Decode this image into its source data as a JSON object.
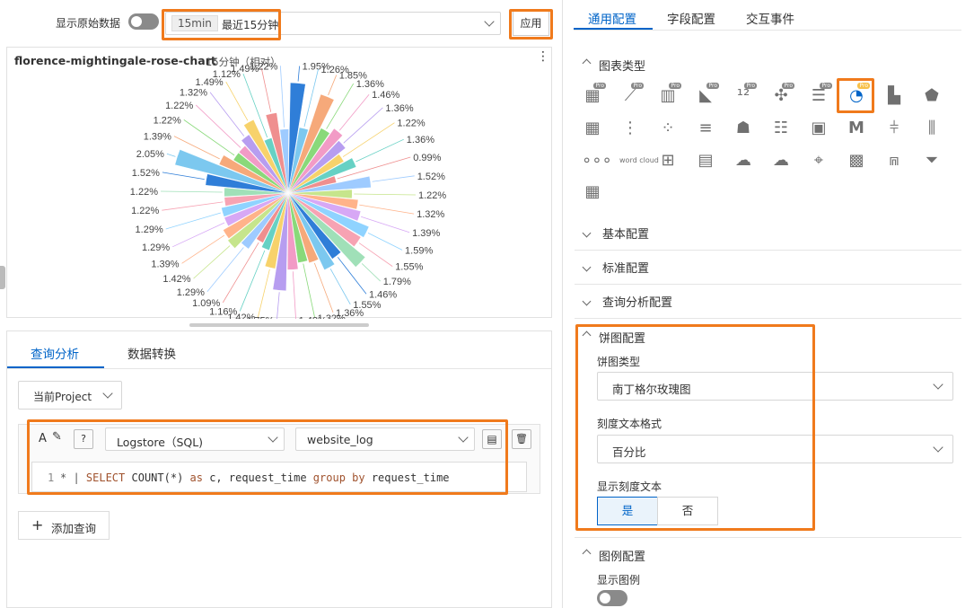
{
  "top": {
    "raw_label": "显示原始数据",
    "time_badge": "15min",
    "time_text": "最近15分钟",
    "apply": "应用"
  },
  "chart_panel": {
    "title": "florence-mightingale-rose-chart",
    "subtitle": "15分钟（相对）"
  },
  "chart_data": {
    "type": "pie",
    "variant": "nightingale-rose",
    "labels": [
      "1.95%",
      "1.26%",
      "1.85%",
      "1.36%",
      "1.46%",
      "1.36%",
      "1.22%",
      "1.36%",
      "0.99%",
      "1.52%",
      "1.22%",
      "1.32%",
      "1.39%",
      "1.59%",
      "1.55%",
      "1.79%",
      "1.46%",
      "1.55%",
      "1.36%",
      "1.32%",
      "1.42%",
      "1.75%",
      "1.42%",
      "1.16%",
      "1.09%",
      "1.29%",
      "1.42%",
      "1.39%",
      "1.29%",
      "1.29%",
      "1.22%",
      "1.22%",
      "1.52%",
      "2.05%",
      "1.39%",
      "1.22%",
      "1.22%",
      "1.32%",
      "1.49%",
      "1.12%",
      "1.49%",
      "1.22%"
    ],
    "values": [
      1.95,
      1.26,
      1.85,
      1.36,
      1.46,
      1.36,
      1.22,
      1.36,
      0.99,
      1.52,
      1.22,
      1.32,
      1.39,
      1.59,
      1.55,
      1.79,
      1.46,
      1.55,
      1.36,
      1.32,
      1.42,
      1.75,
      1.42,
      1.16,
      1.09,
      1.29,
      1.42,
      1.39,
      1.29,
      1.29,
      1.22,
      1.22,
      1.52,
      2.05,
      1.39,
      1.22,
      1.22,
      1.32,
      1.49,
      1.12,
      1.49,
      1.22
    ]
  },
  "query": {
    "tabs": [
      "查询分析",
      "数据转换"
    ],
    "project": "当前Project",
    "store_type": "Logstore（SQL)",
    "store_name": "website_log",
    "line_no": "1",
    "sql_parts": {
      "p1": "* | ",
      "p2": "SELECT",
      "p3": " COUNT(*) ",
      "p4": "as",
      "p5": " c, request_time ",
      "p6": "group by",
      "p7": " request_time"
    },
    "add_query": "添加查询"
  },
  "right": {
    "tabs": [
      "通用配置",
      "字段配置",
      "交互事件"
    ],
    "sections": {
      "chart_type": "图表类型",
      "basic": "基本配置",
      "standard": "标准配置",
      "query_analysis": "查询分析配置",
      "pie": "饼图配置",
      "legend": "图例配置"
    },
    "pie_type_label": "饼图类型",
    "pie_type_value": "南丁格尔玫瑰图",
    "tick_format_label": "刻度文本格式",
    "tick_format_value": "百分比",
    "show_tick_label": "显示刻度文本",
    "yes": "是",
    "no": "否",
    "show_legend": "显示图例",
    "icon_texts": {
      "pro": "Pro",
      "word_cloud": "word cloud",
      "m": "M"
    }
  },
  "colors": {
    "accent": "#0064c8",
    "highlight": "#f07a1c"
  }
}
